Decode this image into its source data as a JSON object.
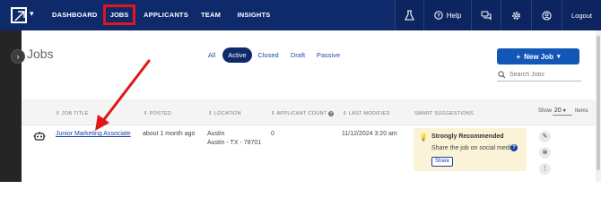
{
  "nav": {
    "items": [
      {
        "label": "DASHBOARD"
      },
      {
        "label": "JOBS"
      },
      {
        "label": "APPLICANTS"
      },
      {
        "label": "TEAM"
      },
      {
        "label": "INSIGHTS"
      }
    ],
    "help_label": "Help",
    "logout_label": "Logout",
    "icons": [
      "flask-icon",
      "help-icon",
      "chat-icon",
      "gear-icon",
      "user-icon"
    ]
  },
  "page": {
    "title": "Jobs",
    "tabs": [
      {
        "label": "All"
      },
      {
        "label": "Active"
      },
      {
        "label": "Closed"
      },
      {
        "label": "Draft"
      },
      {
        "label": "Passive"
      }
    ],
    "new_job_label": "New Job",
    "search_placeholder": "Search Jobs"
  },
  "table": {
    "headers": {
      "job_title": "JOB TITLE",
      "posted": "POSTED",
      "location": "LOCATION",
      "applicant_count": "APPLICANT COUNT",
      "last_modified": "LAST MODIFIED",
      "smart_suggestions": "SMART SUGGESTIONS"
    },
    "show_label": "Show",
    "page_size": "20",
    "items_label": "Items",
    "rows": [
      {
        "job_title": "Junior Marketing Associate",
        "posted": "about 1 month ago",
        "location_line1": "Austin",
        "location_line2": "Austin - TX - 78701",
        "applicant_count": "0",
        "last_modified": "11/12/2024 3:20 am",
        "suggestion_title": "Strongly Recommended",
        "suggestion_text": "Share the job on social media",
        "suggestion_button": "Share"
      }
    ]
  },
  "colors": {
    "nav_bg": "#0e2a6b",
    "accent_blue": "#1257b8",
    "highlight_red": "#e0161b",
    "suggestion_bg": "#fbf3d7"
  }
}
